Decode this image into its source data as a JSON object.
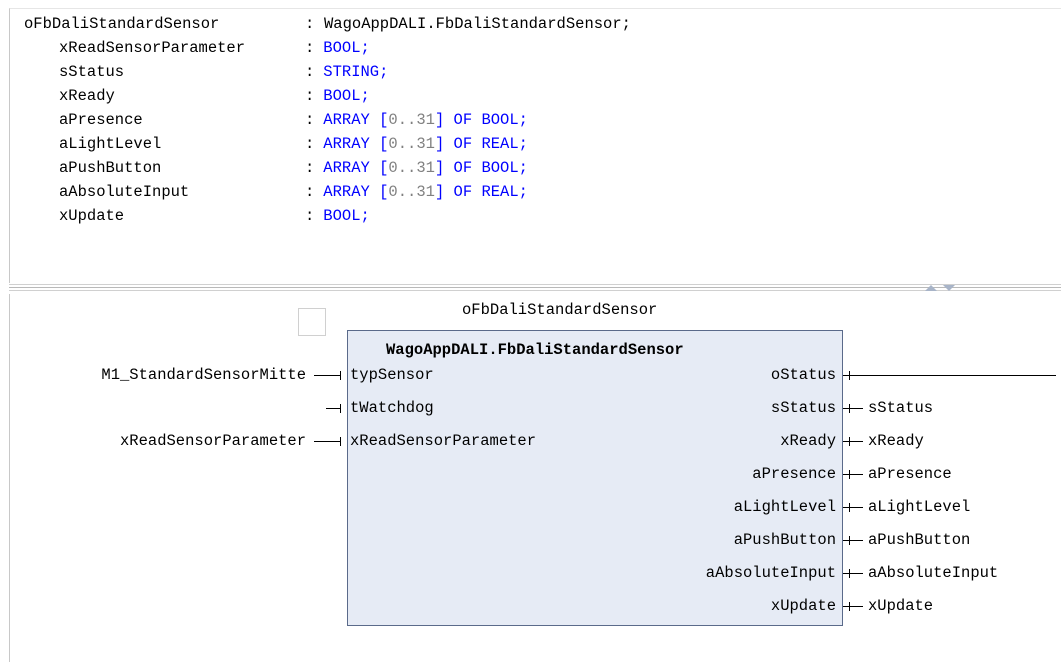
{
  "declaration": {
    "header": {
      "name": "oFbDaliStandardSensor",
      "separator": ":",
      "type": "WagoAppDALI.FbDaliStandardSensor;"
    },
    "lines": [
      {
        "name": "xReadSensorParameter",
        "sep": ":",
        "type_parts": [
          {
            "t": " BOOL;",
            "c": "kw"
          }
        ]
      },
      {
        "name": "sStatus",
        "sep": ":",
        "type_parts": [
          {
            "t": " STRING;",
            "c": "kw"
          }
        ]
      },
      {
        "name": "xReady",
        "sep": ":",
        "type_parts": [
          {
            "t": " BOOL;",
            "c": "kw"
          }
        ]
      },
      {
        "name": "aPresence",
        "sep": ":",
        "type_parts": [
          {
            "t": " ARRAY [",
            "c": "kw"
          },
          {
            "t": "0..31",
            "c": "num"
          },
          {
            "t": "] OF BOOL;",
            "c": "kw"
          }
        ]
      },
      {
        "name": "aLightLevel",
        "sep": ":",
        "type_parts": [
          {
            "t": " ARRAY [",
            "c": "kw"
          },
          {
            "t": "0..31",
            "c": "num"
          },
          {
            "t": "] OF REAL;",
            "c": "kw"
          }
        ]
      },
      {
        "name": "aPushButton",
        "sep": ":",
        "type_parts": [
          {
            "t": " ARRAY [",
            "c": "kw"
          },
          {
            "t": "0..31",
            "c": "num"
          },
          {
            "t": "] OF BOOL;",
            "c": "kw"
          }
        ]
      },
      {
        "name": "aAbsoluteInput",
        "sep": ":",
        "type_parts": [
          {
            "t": " ARRAY [",
            "c": "kw"
          },
          {
            "t": "0..31",
            "c": "num"
          },
          {
            "t": "] OF REAL;",
            "c": "kw"
          }
        ]
      },
      {
        "name": "xUpdate",
        "sep": ":",
        "type_parts": [
          {
            "t": " BOOL;",
            "c": "kw"
          }
        ]
      }
    ]
  },
  "fbd": {
    "instance_name": "oFbDaliStandardSensor",
    "block_type": "WagoAppDALI.FbDaliStandardSensor",
    "inputs": [
      {
        "pin": "typSensor",
        "variable": "M1_StandardSensorMitte"
      },
      {
        "pin": "tWatchdog",
        "variable": ""
      },
      {
        "pin": "xReadSensorParameter",
        "variable": "xReadSensorParameter"
      }
    ],
    "outputs": [
      {
        "pin": "oStatus",
        "variable": ""
      },
      {
        "pin": "sStatus",
        "variable": "sStatus"
      },
      {
        "pin": "xReady",
        "variable": "xReady"
      },
      {
        "pin": "aPresence",
        "variable": "aPresence"
      },
      {
        "pin": "aLightLevel",
        "variable": "aLightLevel"
      },
      {
        "pin": "aPushButton",
        "variable": "aPushButton"
      },
      {
        "pin": "aAbsoluteInput",
        "variable": "aAbsoluteInput"
      },
      {
        "pin": "xUpdate",
        "variable": "xUpdate"
      }
    ]
  },
  "colors": {
    "keyword": "#0000ff",
    "number": "#808080",
    "block_fill": "#e6ebf5",
    "block_border": "#5a6a8a"
  }
}
